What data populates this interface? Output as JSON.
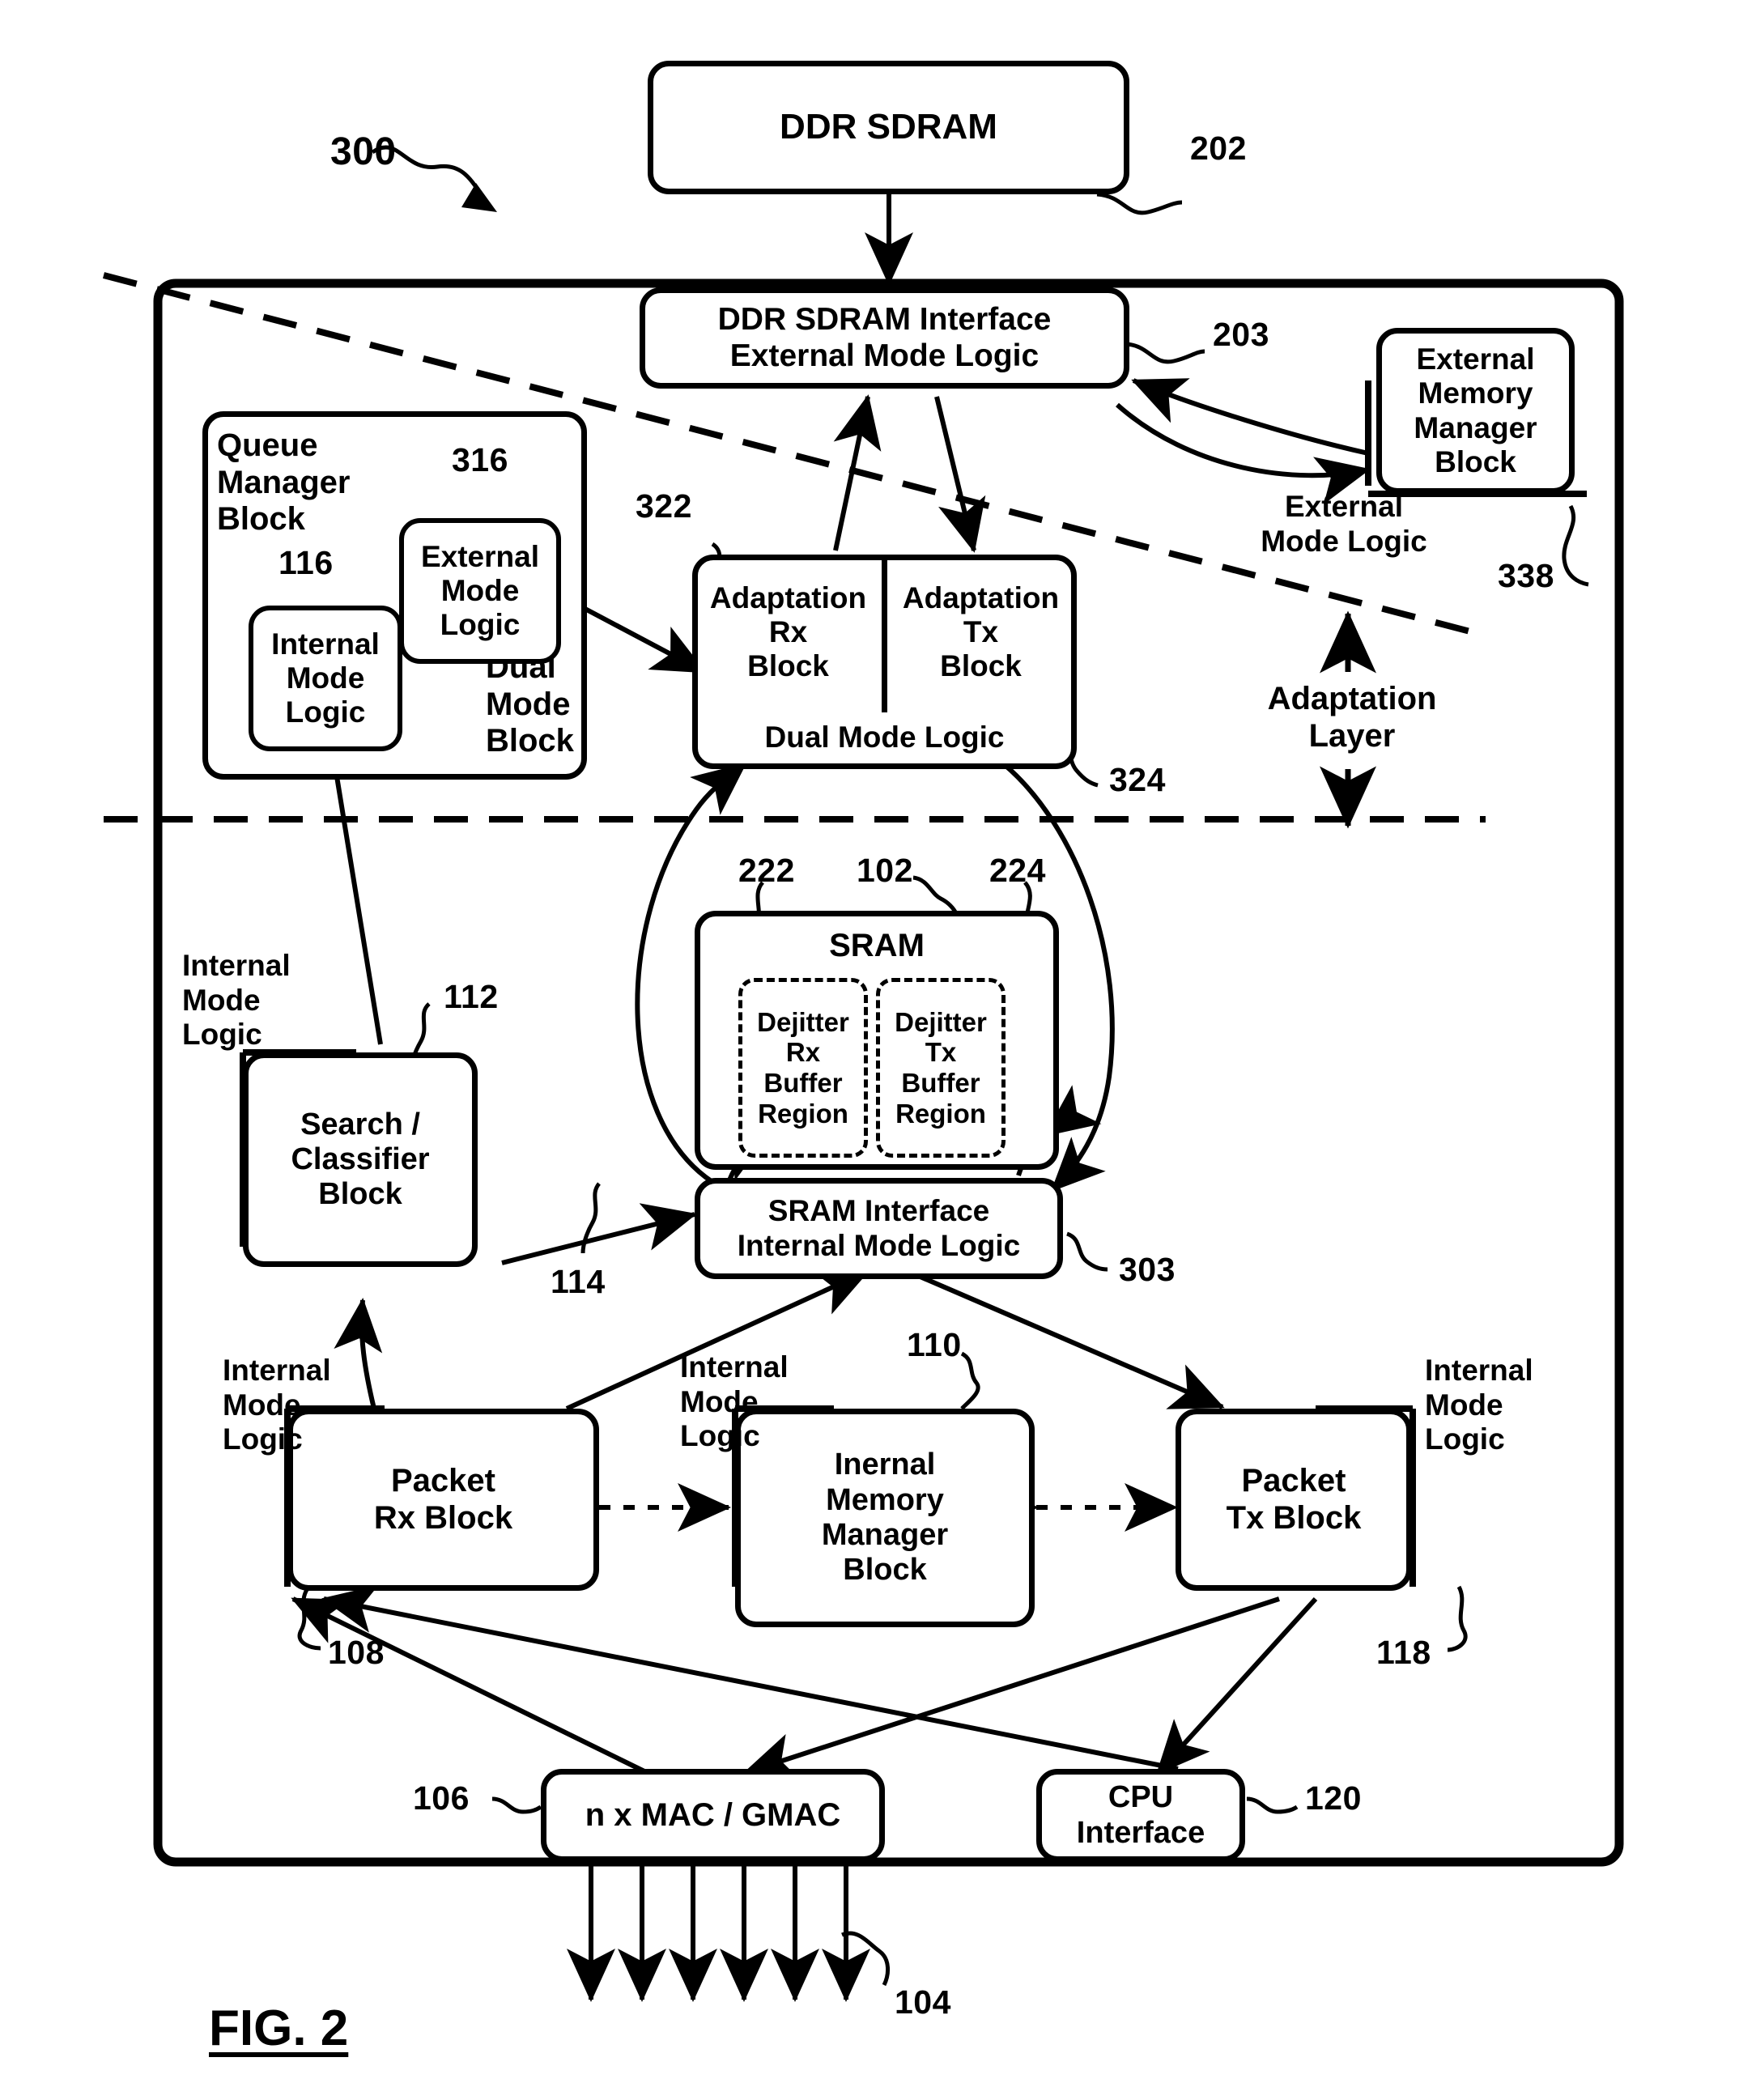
{
  "figure": {
    "label": "FIG. 2",
    "diagram_ref": "300"
  },
  "blocks": {
    "ddr_sdram": {
      "label": "DDR SDRAM",
      "ref": "202"
    },
    "ddr_interface": {
      "line1": "DDR SDRAM Interface",
      "line2": "External Mode Logic",
      "ref": "203"
    },
    "external_memory_manager": {
      "label": "External\nMemory\nManager\nBlock",
      "ref": "338",
      "mode_label": "External\nMode Logic"
    },
    "queue_manager": {
      "title": "Queue\nManager\nBlock",
      "dual_mode": "Dual\nMode\nBlock"
    },
    "qm_internal_mode": {
      "label": "Internal\nMode\nLogic",
      "ref": "116"
    },
    "qm_external_mode": {
      "label": "External\nMode\nLogic",
      "ref": "316"
    },
    "adaptation_rx": {
      "label": "Adaptation\nRx\nBlock",
      "ref": "322"
    },
    "adaptation_tx": {
      "label": "Adaptation\nTx\nBlock",
      "ref": "324"
    },
    "adaptation_dual_mode": {
      "label": "Dual Mode Logic"
    },
    "adaptation_layer": {
      "label": "Adaptation\nLayer"
    },
    "sram": {
      "label": "SRAM",
      "ref": "102"
    },
    "dejitter_rx": {
      "label": "Dejitter\nRx\nBuffer\nRegion",
      "ref": "222"
    },
    "dejitter_tx": {
      "label": "Dejitter\nTx\nBuffer\nRegion",
      "ref": "224"
    },
    "sram_interface": {
      "line1": "SRAM Interface",
      "line2": "Internal Mode Logic",
      "ref": "303"
    },
    "search_classifier": {
      "label": "Search /\nClassifier\nBlock",
      "ref": "112",
      "mode_label": "Internal\nMode\nLogic",
      "link_ref": "114"
    },
    "packet_rx": {
      "label": "Packet\nRx Block",
      "ref": "108",
      "mode_label": "Internal\nMode\nLogic"
    },
    "internal_memory_manager": {
      "label": "Inernal\nMemory\nManager\nBlock",
      "ref": "110",
      "mode_label": "Internal\nMode\nLogic"
    },
    "packet_tx": {
      "label": "Packet\nTx Block",
      "ref": "118",
      "mode_label": "Internal\nMode\nLogic"
    },
    "mac_gmac": {
      "label": "n x MAC / GMAC",
      "ref": "106"
    },
    "cpu_interface": {
      "label": "CPU\nInterface",
      "ref": "120"
    },
    "external_ports": {
      "ref": "104"
    }
  },
  "colors": {
    "ink": "#000000",
    "paper": "#ffffff"
  }
}
